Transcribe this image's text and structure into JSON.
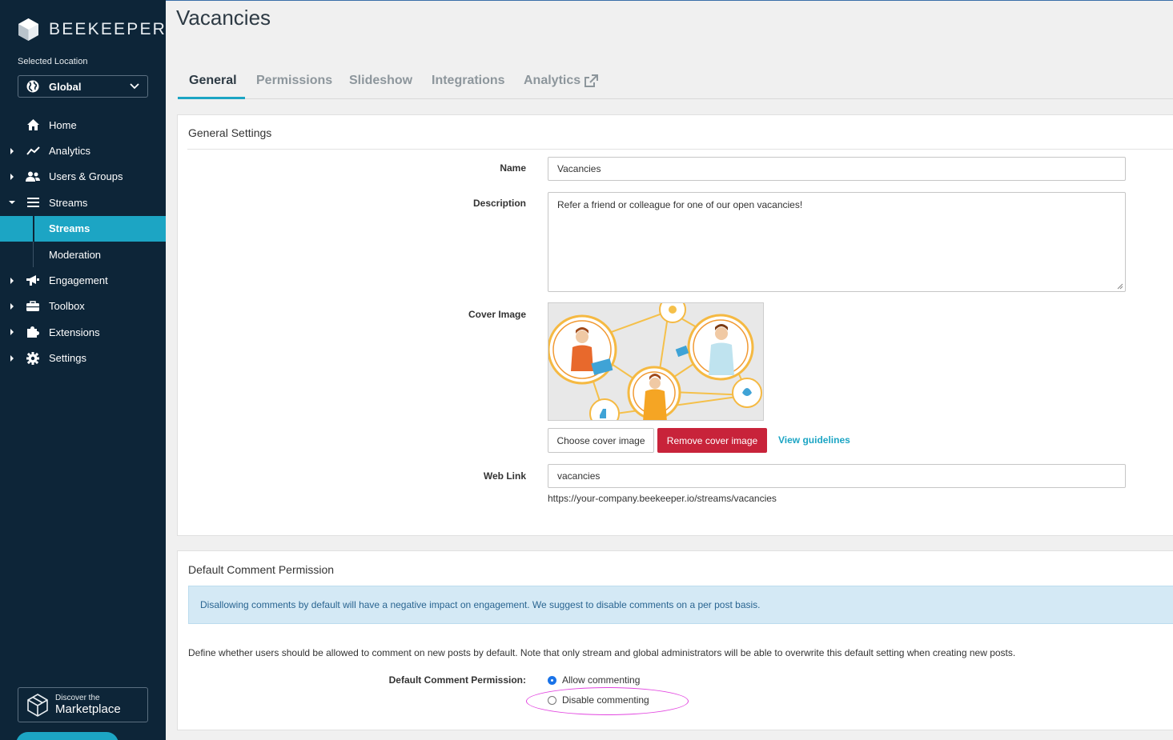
{
  "sidebar": {
    "brand": "BEEKEEPER",
    "location_label": "Selected Location",
    "location_value": "Global",
    "nav": [
      {
        "label": "Home",
        "icon": "home-icon"
      },
      {
        "label": "Analytics",
        "icon": "chart-line-icon"
      },
      {
        "label": "Users & Groups",
        "icon": "users-icon"
      },
      {
        "label": "Streams",
        "icon": "list-icon"
      },
      {
        "label": "Streams",
        "icon": ""
      },
      {
        "label": "Moderation",
        "icon": ""
      },
      {
        "label": "Engagement",
        "icon": "megaphone-icon"
      },
      {
        "label": "Toolbox",
        "icon": "toolbox-icon"
      },
      {
        "label": "Extensions",
        "icon": "puzzle-icon"
      },
      {
        "label": "Settings",
        "icon": "gear-icon"
      }
    ],
    "marketplace_line1": "Discover the",
    "marketplace_line2": "Marketplace"
  },
  "page": {
    "title": "Vacancies",
    "tabs": [
      "General",
      "Permissions",
      "Slideshow",
      "Integrations",
      "Analytics"
    ]
  },
  "general": {
    "heading": "General Settings",
    "name_label": "Name",
    "name_value": "Vacancies",
    "description_label": "Description",
    "description_value": "Refer a friend or colleague for one of our open vacancies!",
    "cover_label": "Cover Image",
    "choose_cover": "Choose cover image",
    "remove_cover": "Remove cover image",
    "view_guidelines": "View guidelines",
    "weblink_label": "Web Link",
    "weblink_value": "vacancies",
    "weblink_url": "https://your-company.beekeeper.io/streams/vacancies"
  },
  "comments": {
    "heading": "Default Comment Permission",
    "alert": "Disallowing comments by default will have a negative impact on engagement. We suggest to disable comments on a per post basis.",
    "description": "Define whether users should be allowed to comment on new posts by default. Note that only stream and global administrators will be able to overwrite this default setting when creating new posts.",
    "field_label": "Default Comment Permission:",
    "option_allow": "Allow commenting",
    "option_disable": "Disable commenting",
    "selected": "Allow commenting"
  },
  "colors": {
    "sidebar_bg": "#0d2538",
    "accent": "#1ca5c4",
    "danger": "#c8233a",
    "highlight": "#e245e0"
  }
}
